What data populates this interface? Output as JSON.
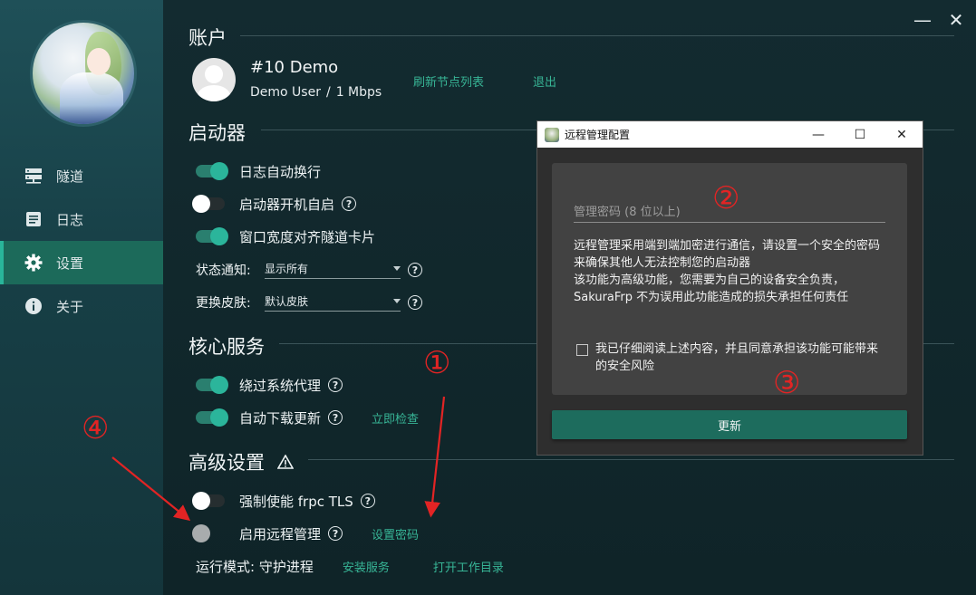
{
  "sidebar": {
    "items": [
      {
        "label": "隧道",
        "icon": "server-icon"
      },
      {
        "label": "日志",
        "icon": "log-icon"
      },
      {
        "label": "设置",
        "icon": "gear-icon"
      },
      {
        "label": "关于",
        "icon": "info-icon"
      }
    ],
    "active": "设置"
  },
  "window": {
    "minimize": "—",
    "close": "✕"
  },
  "account": {
    "title": "账户",
    "name": "#10 Demo",
    "user": "Demo User",
    "separator": "/",
    "speed": "1 Mbps",
    "refresh_link": "刷新节点列表",
    "logout_link": "退出"
  },
  "launcher": {
    "title": "启动器",
    "log_wrap": "日志自动换行",
    "autostart": "启动器开机自启",
    "window_width": "窗口宽度对齐隧道卡片",
    "notify_label": "状态通知:",
    "notify_value": "显示所有",
    "skin_label": "更换皮肤:",
    "skin_value": "默认皮肤"
  },
  "core": {
    "title": "核心服务",
    "bypass_proxy": "绕过系统代理",
    "auto_update": "自动下载更新",
    "check_now": "立即检查"
  },
  "advanced": {
    "title": "高级设置",
    "force_tls": "强制使能 frpc TLS",
    "remote_mgmt": "启用远程管理",
    "set_password": "设置密码",
    "run_mode": "运行模式: 守护进程",
    "install_service": "安装服务",
    "open_workdir": "打开工作目录"
  },
  "dialog": {
    "title": "远程管理配置",
    "min": "—",
    "max": "☐",
    "close": "✕",
    "password_placeholder": "管理密码 (8 位以上)",
    "description": "远程管理采用端到端加密进行通信，请设置一个安全的密码来确保其他人无法控制您的启动器\n该功能为高级功能，您需要为自己的设备安全负责，SakuraFrp 不为误用此功能造成的损失承担任何责任",
    "agree": "我已仔细阅读上述内容，并且同意承担该功能可能带来的安全风险",
    "update_button": "更新"
  },
  "annotations": {
    "m1": "①",
    "m2": "②",
    "m3": "③",
    "m4": "④",
    "color": "#e22424"
  },
  "colors": {
    "accent": "#2bb59b",
    "link": "#37b596",
    "sidebar_active": "#1c6a5a",
    "primary_button": "#1d6c5d"
  }
}
